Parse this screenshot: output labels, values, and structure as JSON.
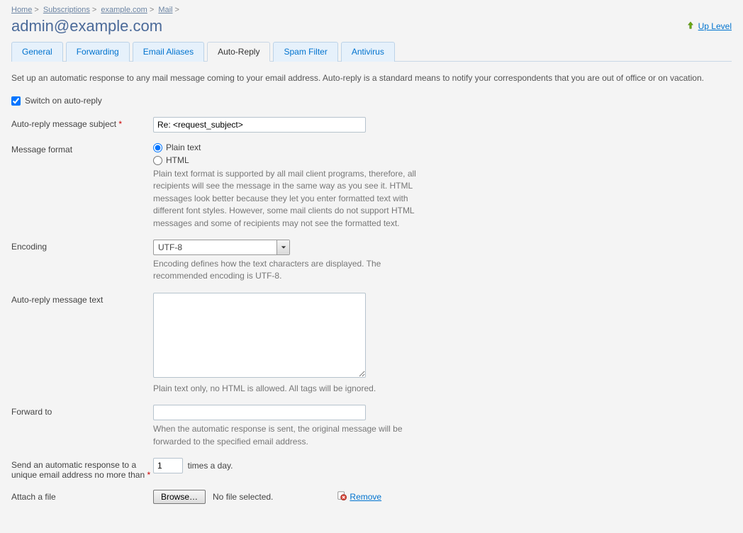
{
  "breadcrumb": {
    "items": [
      "Home",
      "Subscriptions",
      "example.com",
      "Mail"
    ]
  },
  "title": "admin@example.com",
  "up_level": "Up Level",
  "tabs": {
    "general": "General",
    "forwarding": "Forwarding",
    "aliases": "Email Aliases",
    "autoreply": "Auto-Reply",
    "spam": "Spam Filter",
    "antivirus": "Antivirus"
  },
  "intro": "Set up an automatic response to any mail message coming to your email address. Auto-reply is a standard means to notify your correspondents that you are out of office or on vacation.",
  "switch": {
    "label": "Switch on auto-reply",
    "checked": true
  },
  "subject": {
    "label": "Auto-reply message subject",
    "value": "Re: <request_subject>"
  },
  "format": {
    "label": "Message format",
    "plain": "Plain text",
    "html": "HTML",
    "selected": "plain",
    "help": "Plain text format is supported by all mail client programs, therefore, all recipients will see the message in the same way as you see it. HTML messages look better because they let you enter formatted text with different font styles. However, some mail clients do not support HTML messages and some of recipients may not see the formatted text."
  },
  "encoding": {
    "label": "Encoding",
    "value": "UTF-8",
    "help": "Encoding defines how the text characters are displayed. The recommended encoding is UTF-8."
  },
  "message": {
    "label": "Auto-reply message text",
    "value": "",
    "help": "Plain text only, no HTML is allowed. All tags will be ignored."
  },
  "forward": {
    "label": "Forward to",
    "value": "",
    "help": "When the automatic response is sent, the original message will be forwarded to the specified email address."
  },
  "limit": {
    "label": "Send an automatic response to a unique email address no more than",
    "value": "1",
    "suffix": "times a day."
  },
  "attach": {
    "label": "Attach a file",
    "browse": "Browse…",
    "status": "No file selected.",
    "remove": "Remove"
  }
}
